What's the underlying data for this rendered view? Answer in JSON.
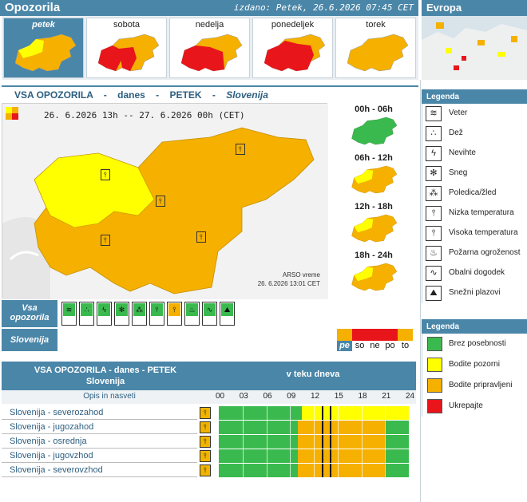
{
  "header": {
    "title": "Opozorila",
    "issued": "izdano: Petek, 26.6.2026 07:45 CET",
    "europe": "Evropa"
  },
  "days": [
    {
      "label": "petek",
      "selected": true
    },
    {
      "label": "sobota",
      "selected": false
    },
    {
      "label": "nedelja",
      "selected": false
    },
    {
      "label": "ponedeljek",
      "selected": false
    },
    {
      "label": "torek",
      "selected": false
    }
  ],
  "subheader": {
    "prefix": "VSA OPOZORILA",
    "sep": "-",
    "today": "danes",
    "day": "PETEK",
    "region": "Slovenija"
  },
  "map": {
    "datetime": "26. 6.2026  13h  --  27. 6.2026  00h    (CET)",
    "source": "ARSO vreme",
    "source_time": "26. 6.2026  13:01 CET"
  },
  "slots": [
    {
      "label": "00h - 06h"
    },
    {
      "label": "06h - 12h"
    },
    {
      "label": "12h - 18h"
    },
    {
      "label": "18h - 24h"
    }
  ],
  "row_labels": {
    "vsa": "Vsa opozorila",
    "slo": "Slovenija"
  },
  "day_abbr": [
    {
      "label": "pe",
      "color": "#f5b000",
      "selected": true
    },
    {
      "label": "so",
      "color": "#e8151b",
      "selected": false
    },
    {
      "label": "ne",
      "color": "#e8151b",
      "selected": false
    },
    {
      "label": "po",
      "color": "#e8151b",
      "selected": false
    },
    {
      "label": "to",
      "color": "#f5b000",
      "selected": false
    }
  ],
  "legend_types": {
    "title": "Legenda",
    "items": [
      {
        "label": "Veter",
        "icon": "wind-icon",
        "glyph": "≋"
      },
      {
        "label": "Dež",
        "icon": "rain-icon",
        "glyph": "∴"
      },
      {
        "label": "Nevihte",
        "icon": "thunderstorm-icon",
        "glyph": "ϟ"
      },
      {
        "label": "Sneg",
        "icon": "snow-icon",
        "glyph": "✻"
      },
      {
        "label": "Poledica/žled",
        "icon": "ice-icon",
        "glyph": "⁂"
      },
      {
        "label": "Nizka temperatura",
        "icon": "low-temperature-icon",
        "glyph": "⫯"
      },
      {
        "label": "Visoka temperatura",
        "icon": "high-temperature-icon",
        "glyph": "⫯"
      },
      {
        "label": "Požarna ogroženost",
        "icon": "fire-icon",
        "glyph": "♨"
      },
      {
        "label": "Obalni dogodek",
        "icon": "coastal-icon",
        "glyph": "∿"
      },
      {
        "label": "Snežni plazovi",
        "icon": "avalanche-icon",
        "glyph": "⛰"
      }
    ]
  },
  "legend_levels": {
    "title": "Legenda",
    "items": [
      {
        "label": "Brez posebnosti",
        "color": "#3aba4e"
      },
      {
        "label": "Bodite pozorni",
        "color": "#ffff00"
      },
      {
        "label": "Bodite pripravljeni",
        "color": "#f5b000"
      },
      {
        "label": "Ukrepajte",
        "color": "#e8151b"
      }
    ]
  },
  "table": {
    "title": "VSA OPOZORILA - danes - PETEK",
    "region": "Slovenija",
    "during": "v teku dneva",
    "opis": "Opis in nasveti",
    "ticks": [
      "00",
      "03",
      "06",
      "09",
      "12",
      "15",
      "18",
      "21",
      "24"
    ],
    "rows": [
      {
        "name": "Slovenija - severozahod",
        "segments": [
          [
            0,
            10.5,
            "#3aba4e"
          ],
          [
            10.5,
            24,
            "#ffff00"
          ]
        ]
      },
      {
        "name": "Slovenija - jugozahod",
        "segments": [
          [
            0,
            10,
            "#3aba4e"
          ],
          [
            10,
            21,
            "#f5b000"
          ],
          [
            21,
            24,
            "#3aba4e"
          ]
        ]
      },
      {
        "name": "Slovenija - osrednja",
        "segments": [
          [
            0,
            10,
            "#3aba4e"
          ],
          [
            10,
            21,
            "#f5b000"
          ],
          [
            21,
            24,
            "#3aba4e"
          ]
        ]
      },
      {
        "name": "Slovenija - jugovzhod",
        "segments": [
          [
            0,
            10,
            "#3aba4e"
          ],
          [
            10,
            21,
            "#f5b000"
          ],
          [
            21,
            24,
            "#3aba4e"
          ]
        ]
      },
      {
        "name": "Slovenija - severovzhod",
        "segments": [
          [
            0,
            10,
            "#3aba4e"
          ],
          [
            10,
            21,
            "#f5b000"
          ],
          [
            21,
            24,
            "#3aba4e"
          ]
        ]
      }
    ],
    "markers": [
      13,
      14
    ]
  },
  "colors": {
    "header": "#4a86a8",
    "green": "#3aba4e",
    "yellow": "#ffff00",
    "orange": "#f5b000",
    "red": "#e8151b"
  }
}
